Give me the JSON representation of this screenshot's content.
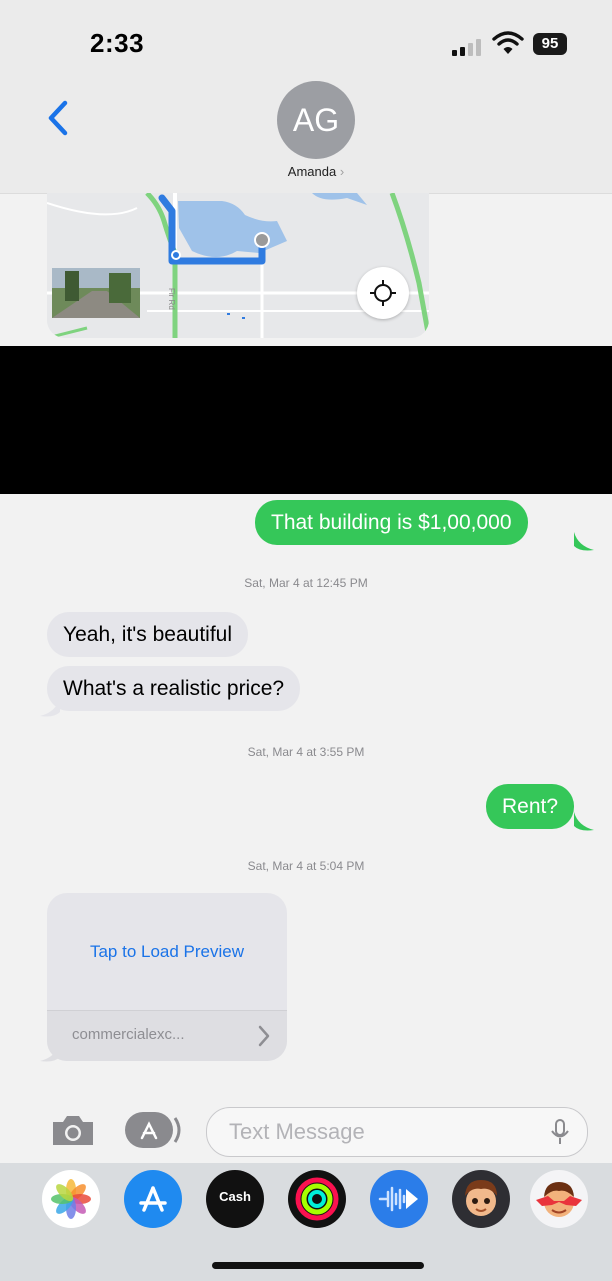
{
  "status_bar": {
    "time": "2:33",
    "battery": "95",
    "signal_bars_active": 2,
    "signal_bars_total": 4
  },
  "header": {
    "avatar_initials": "AG",
    "contact_name": "Amanda",
    "contact_chevron": "›",
    "back_icon": "chevron-left-icon"
  },
  "map_attachment": {
    "road_label": "Fir Rd",
    "icons": [
      "location-crosshair-icon"
    ]
  },
  "messages": [
    {
      "id": "m1",
      "kind": "sent",
      "text": "That building is $1,00,000"
    },
    {
      "id": "t1",
      "kind": "timestamp",
      "text": "Sat, Mar 4 at 12:45 PM"
    },
    {
      "id": "m2",
      "kind": "received",
      "text": "Yeah, it's beautiful"
    },
    {
      "id": "m3",
      "kind": "received",
      "text": "What's a realistic price?"
    },
    {
      "id": "t2",
      "kind": "timestamp",
      "text": "Sat, Mar 4 at 3:55 PM"
    },
    {
      "id": "m4",
      "kind": "sent",
      "text": "Rent?"
    },
    {
      "id": "t3",
      "kind": "timestamp",
      "text": "Sat, Mar 4 at 5:04 PM"
    }
  ],
  "link_preview": {
    "action": "Tap to Load Preview",
    "domain": "commercialexc...",
    "chevron": "›"
  },
  "input_bar": {
    "placeholder": "Text Message"
  },
  "app_drawer": {
    "cash_label": "Cash",
    "apps": [
      "photos-icon",
      "app-store-icon",
      "apple-cash-icon",
      "activity-icon",
      "audio-message-icon",
      "memoji-icon",
      "memoji-stickers-icon"
    ]
  },
  "colors": {
    "sent_bubble": "#35c759",
    "received_bubble": "#e5e5ea",
    "link": "#1a73e8",
    "back_chevron": "#1a73e8"
  }
}
